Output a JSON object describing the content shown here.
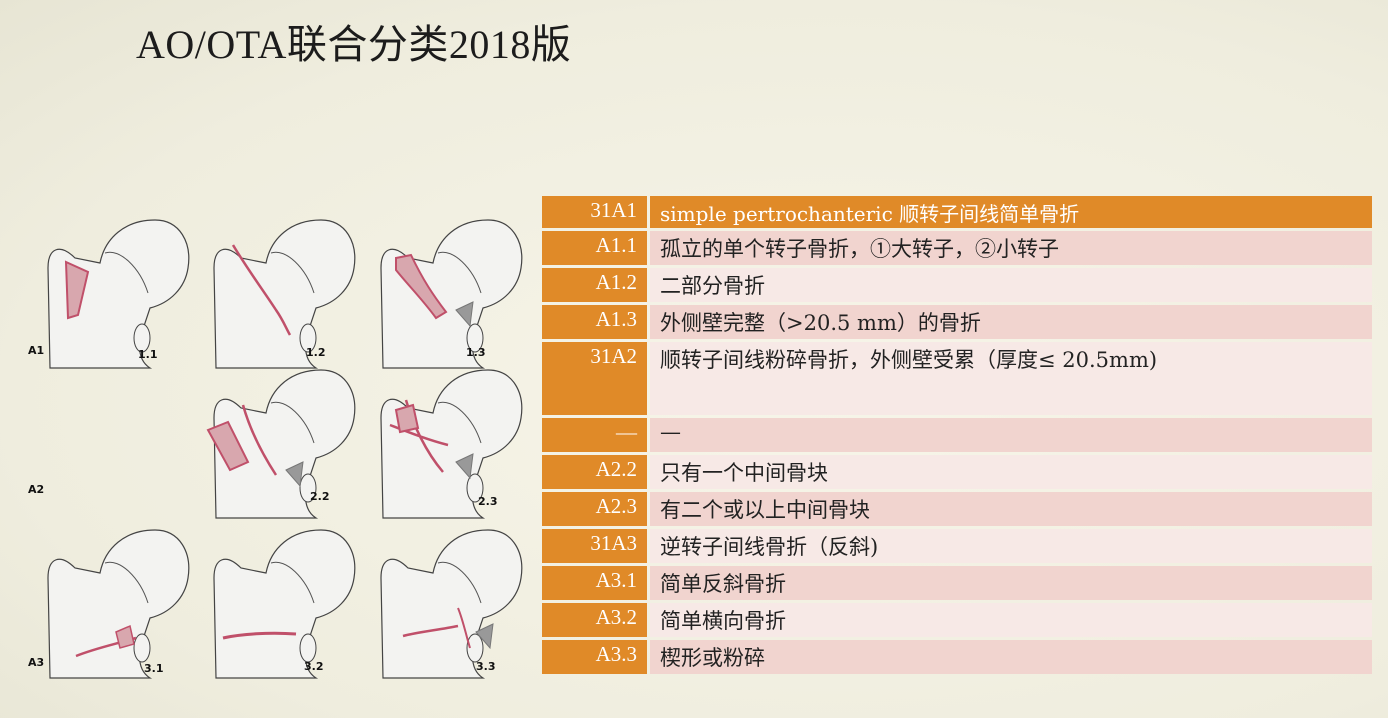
{
  "title": "AO/OTA联合分类2018版",
  "figure": {
    "row_labels": [
      "A1",
      "A2",
      "A3"
    ],
    "panel_labels": [
      "1.1",
      "1.2",
      "1.3",
      "2.2",
      "2.3",
      "3.1",
      "3.2",
      "3.3"
    ]
  },
  "table": {
    "rows": [
      {
        "code": "31A1",
        "desc": "simple pertrochanteric 顺转子间线简单骨折",
        "style": "header"
      },
      {
        "code": "A1.1",
        "desc": "孤立的单个转子骨折，①大转子，②小转子",
        "style": "pink"
      },
      {
        "code": "A1.2",
        "desc": "二部分骨折",
        "style": "light"
      },
      {
        "code": "A1.3",
        "desc": "外侧壁完整（>20.5 mm）的骨折",
        "style": "pink"
      },
      {
        "code": "31A2",
        "desc": "顺转子间线粉碎骨折，外侧壁受累（厚度≤ 20.5mm)",
        "style": "light",
        "tall": true
      },
      {
        "code": "—",
        "desc": "—",
        "style": "pink"
      },
      {
        "code": "A2.2",
        "desc": "只有一个中间骨块",
        "style": "light"
      },
      {
        "code": "A2.3",
        "desc": "有二个或以上中间骨块",
        "style": "pink"
      },
      {
        "code": "31A3",
        "desc": "逆转子间线骨折（反斜)",
        "style": "light"
      },
      {
        "code": "A3.1",
        "desc": "简单反斜骨折",
        "style": "pink"
      },
      {
        "code": "A3.2",
        "desc": "简单横向骨折",
        "style": "light"
      },
      {
        "code": "A3.3",
        "desc": "楔形或粉碎",
        "style": "pink"
      }
    ]
  },
  "colors": {
    "orange": "#e08a28",
    "pink": "#f1d4cf",
    "light_pink": "#f7e9e6",
    "fracture_line": "#c0506a"
  }
}
